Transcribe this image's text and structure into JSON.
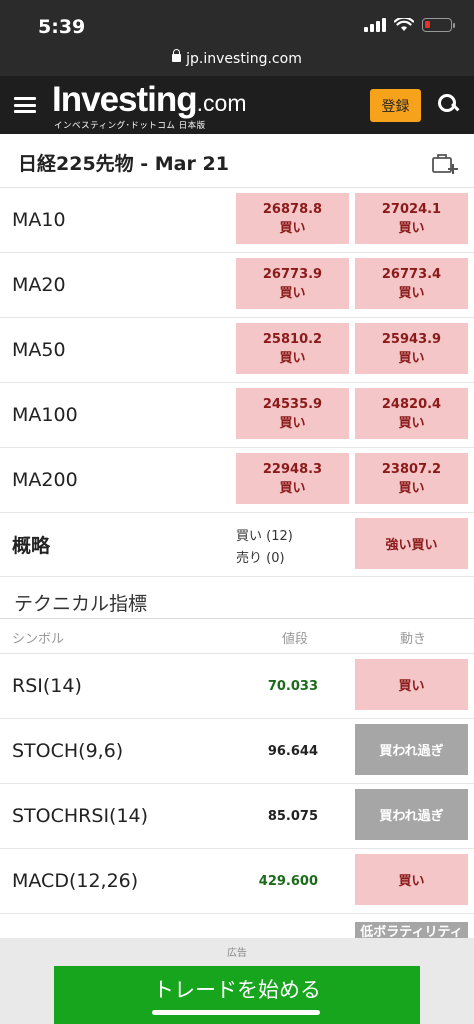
{
  "status": {
    "time": "5:39"
  },
  "browser": {
    "url": "jp.investing.com"
  },
  "header": {
    "logo_main": "Investing",
    "logo_dotcom": ".com",
    "logo_sub": "インベスティング･ドットコム 日本版",
    "register_label": "登録"
  },
  "page": {
    "title": "日経225先物 - Mar 21"
  },
  "moving_averages": [
    {
      "name": "MA10",
      "simple_value": "26878.8",
      "simple_signal": "買い",
      "exp_value": "27024.1",
      "exp_signal": "買い"
    },
    {
      "name": "MA20",
      "simple_value": "26773.9",
      "simple_signal": "買い",
      "exp_value": "26773.4",
      "exp_signal": "買い"
    },
    {
      "name": "MA50",
      "simple_value": "25810.2",
      "simple_signal": "買い",
      "exp_value": "25943.9",
      "exp_signal": "買い"
    },
    {
      "name": "MA100",
      "simple_value": "24535.9",
      "simple_signal": "買い",
      "exp_value": "24820.4",
      "exp_signal": "買い"
    },
    {
      "name": "MA200",
      "simple_value": "22948.3",
      "simple_signal": "買い",
      "exp_value": "23807.2",
      "exp_signal": "買い"
    }
  ],
  "summary": {
    "label": "概略",
    "buy": "買い (12)",
    "sell": "売り (0)",
    "signal": "強い買い"
  },
  "technical": {
    "title": "テクニカル指標",
    "col_symbol": "シンボル",
    "col_value": "値段",
    "col_action": "動き",
    "rows": [
      {
        "name": "RSI(14)",
        "value": "70.033",
        "action": "買い",
        "value_color": "#1a6b1a",
        "kind": "buy"
      },
      {
        "name": "STOCH(9,6)",
        "value": "96.644",
        "action": "買われ過ぎ",
        "value_color": "#222222",
        "kind": "over"
      },
      {
        "name": "STOCHRSI(14)",
        "value": "85.075",
        "action": "買われ過ぎ",
        "value_color": "#222222",
        "kind": "over"
      },
      {
        "name": "MACD(12,26)",
        "value": "429.600",
        "action": "買い",
        "value_color": "#1a6b1a",
        "kind": "buy"
      }
    ],
    "partial_action": "低ボラティリティ"
  },
  "ad": {
    "label": "広告",
    "button": "トレードを始める"
  },
  "colors": {
    "buy_bg": "#f4c6c8",
    "buy_text": "#8b1a1a",
    "over_bg": "#a6a6a6",
    "accent": "#f7a21b",
    "ad_green": "#16a51c"
  }
}
